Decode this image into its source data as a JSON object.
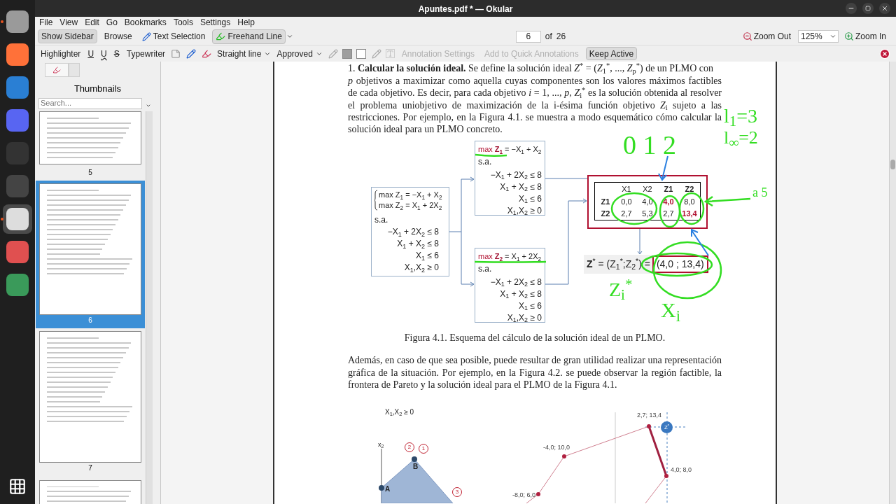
{
  "window": {
    "title": "Apuntes.pdf * — Okular"
  },
  "menu": [
    "File",
    "View",
    "Edit",
    "Go",
    "Bookmarks",
    "Tools",
    "Settings",
    "Help"
  ],
  "toolbar": {
    "show_sidebar": {
      "label": "Show Sidebar",
      "pressed": true
    },
    "modes": [
      {
        "label": "Browse",
        "kind": "plain",
        "selected": false
      },
      {
        "label": "Text Selection",
        "kind": "pen",
        "selected": false
      },
      {
        "label": "Freehand Line",
        "kind": "freehand",
        "selected": true
      }
    ],
    "page": "6",
    "of": "of",
    "total": "26",
    "zoom_out": "Zoom Out",
    "zoom": "125%",
    "zoom_in": "Zoom In"
  },
  "annotation_bar": {
    "tools": [
      {
        "label": "Highlighter",
        "kind": "text"
      },
      {
        "label": "U",
        "kind": "underline"
      },
      {
        "label": "U",
        "kind": "squiggle"
      },
      {
        "label": "S",
        "kind": "strike"
      },
      {
        "label": "Typewriter",
        "kind": "text"
      }
    ],
    "line_tool": "Straight line",
    "stamp": "Approved",
    "settings": {
      "label": "Annotation Settings",
      "disabled": true
    },
    "quick": {
      "label": "Add to Quick Annotations",
      "disabled": true
    },
    "keep_active": {
      "label": "Keep Active",
      "pressed": true
    }
  },
  "sidebar": {
    "title": "Thumbnails",
    "search_placeholder": "Search...",
    "thumbnails": [
      {
        "page": "5",
        "selected": false
      },
      {
        "page": "6",
        "selected": true
      },
      {
        "page": "7",
        "selected": false
      }
    ]
  },
  "document": {
    "cut_line": "1. **Calcular la solución ideal.** Se define la solución ideal *Z*$^{*}$ = (*Z*$_{1}$$^{*}$, ..., *Z*$_{p}$$^{*}$) de un PLMO con",
    "paragraph_1": "*p* objetivos a maximizar como aquella cuyas componentes son los valores máximos factibles de cada objetivo. Es decir, para cada objetivo *i* = 1, ..., *p*, *Z*$_{i}$$^{*}$ es la solución obtenida al resolver el problema uniobjetivo de maximización de la i-ésima función objetivo *Z*$_{i}$ sujeto a las restricciones. Por ejemplo, en la Figura 4.1. se muestra a modo esquemático cómo calcular la solución ideal para un PLMO concreto.",
    "figure_1": {
      "problem": {
        "objectives": [
          "max  Z$_{1}$ = −X$_{1}$ + X$_{2}$",
          "max  Z$_{2}$ = X$_{1}$ + 2X$_{2}$"
        ],
        "subject_to": "s.a.",
        "constraints": [
          "−X$_{1}$ + 2X$_{2}$ ≤ 8",
          "X$_{1}$ + X$_{2}$ ≤ 8",
          "X$_{1}$ ≤ 6",
          "X$_{1}$,X$_{2}$ ≥ 0"
        ]
      },
      "subproblems": [
        {
          "keyword": "max",
          "variable": "Z$_{1}$",
          "expression": "= −X$_{1}$ + X$_{2}$",
          "subject_to": "s.a.",
          "constraints": [
            "−X$_{1}$ + 2X$_{2}$ ≤ 8",
            "X$_{1}$ + X$_{2}$ ≤ 8",
            "X$_{1}$ ≤ 6",
            "X$_{1}$,X$_{2}$ ≥ 0"
          ]
        },
        {
          "keyword": "max",
          "variable": "Z$_{2}$",
          "expression": "= X$_{1}$ + 2X$_{2}$",
          "subject_to": "s.a.",
          "constraints": [
            "−X$_{1}$ + 2X$_{2}$ ≤ 8",
            "X$_{1}$ + X$_{2}$ ≤ 8",
            "X$_{1}$ ≤ 6",
            "X$_{1}$,X$_{2}$ ≥ 0"
          ]
        }
      ],
      "table": {
        "columns": [
          {
            "text": "X1",
            "bold": false
          },
          {
            "text": "X2",
            "bold": false
          },
          {
            "text": "Z1",
            "bold": true
          },
          {
            "text": "Z2",
            "bold": true
          }
        ],
        "rows": [
          {
            "label": "Z1",
            "cells": [
              {
                "text": "0,0",
                "highlighted": false
              },
              {
                "text": "4,0",
                "highlighted": false
              },
              {
                "text": "4,0",
                "highlighted": true
              },
              {
                "text": "8,0",
                "highlighted": false
              }
            ]
          },
          {
            "label": "Z2",
            "cells": [
              {
                "text": "2,7",
                "highlighted": false
              },
              {
                "text": "5,3",
                "highlighted": false
              },
              {
                "text": "2,7",
                "highlighted": false
              },
              {
                "text": "13,4",
                "highlighted": true
              }
            ]
          }
        ]
      },
      "ideal": {
        "formula": "**Z**$^{*}$ = (Z$_{1}$$^{*}$;Z$_{2}$$^{*}$) =",
        "value": "(4,0 ; 13,4)"
      },
      "caption": "Figura 4.1. Esquema del cálculo de la solución ideal de un PLMO."
    },
    "paragraph_2": "Además, en caso de que sea posible, puede resultar de gran utilidad realizar una representación gráfica de la situación. Por ejemplo, en la Figura 4.2. se puede observar la región factible, la frontera de Pareto y la solución ideal para el PLMO de la Figura 4.1.",
    "figure_2": {
      "region_label": "X$_{1}$,X$_{2}$ ≥ 0",
      "axis_label": "x$_{2}$",
      "vertices": [
        "A",
        "B"
      ],
      "constraint_marks": [
        "2",
        "1",
        "3"
      ],
      "points": [
        "2,7; 13,4",
        "-4,0; 10,0",
        "4,0; 8,0",
        "-8,0; 6,0"
      ],
      "ideal": "Z$^{*}$"
    },
    "ink_notes": [
      "l$_{1}$=3",
      "l$_{∞}$=2",
      "0  1  2",
      "a  5",
      "Z$_{i}$$^{*}$",
      "X$_{i}$"
    ]
  }
}
